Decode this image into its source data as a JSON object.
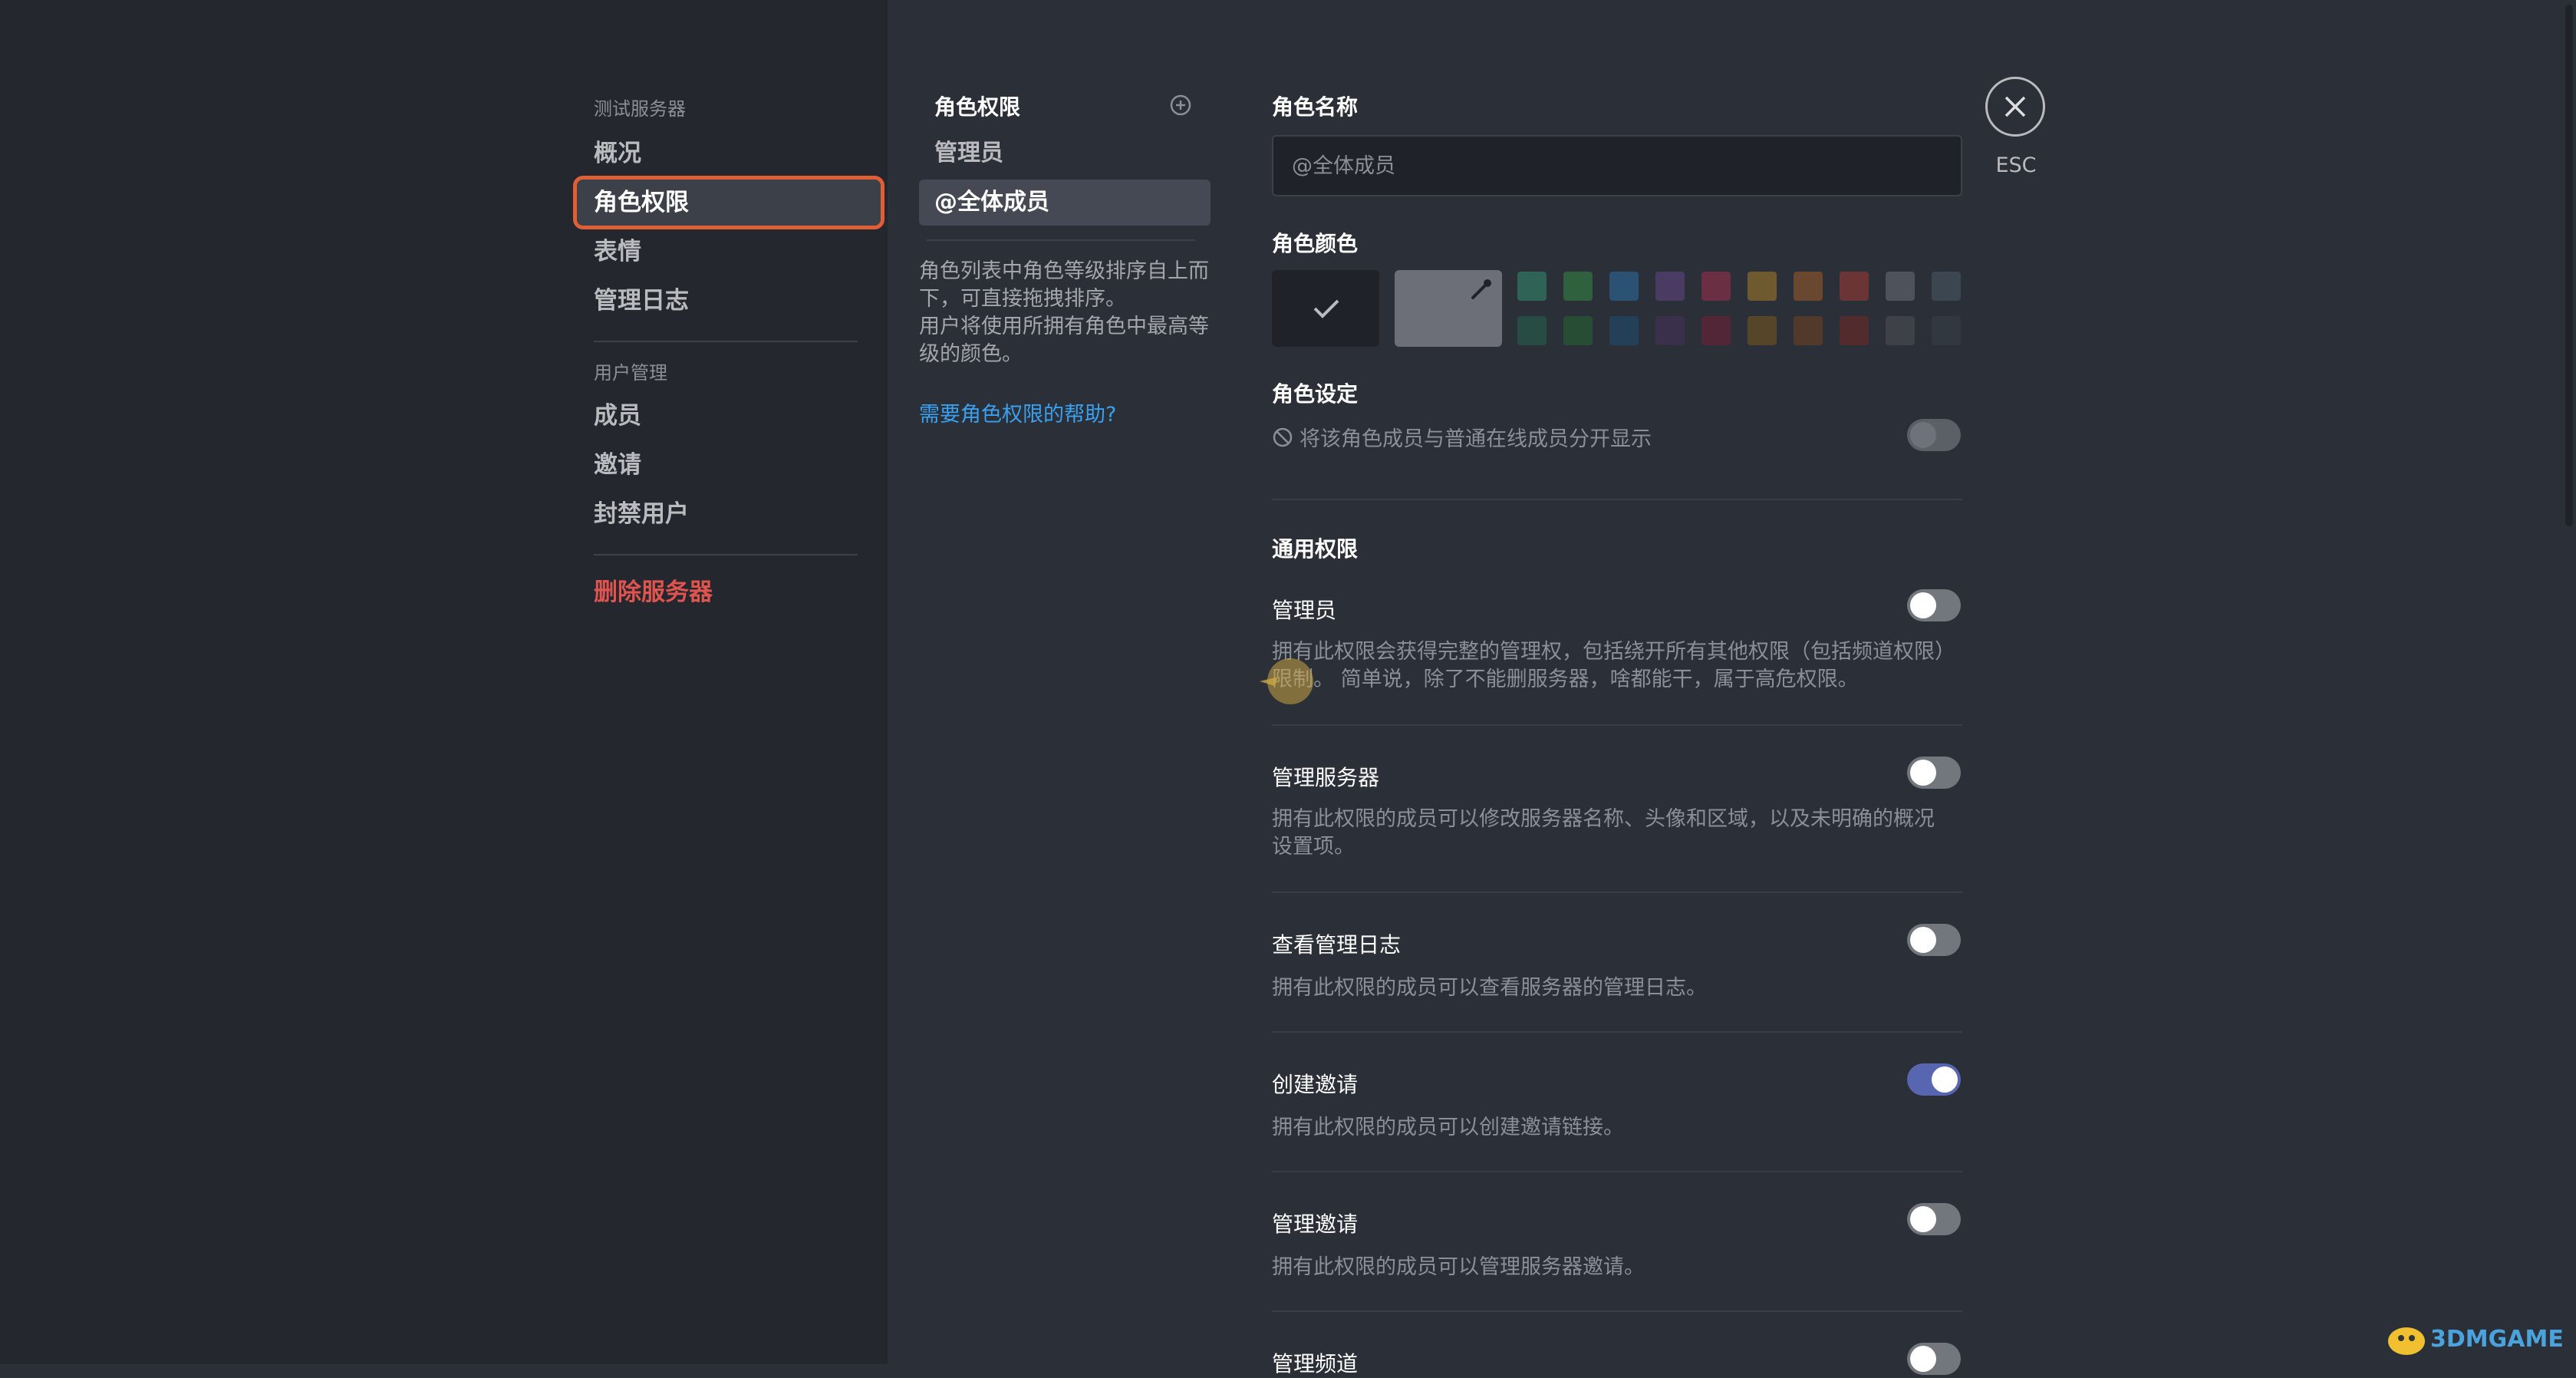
{
  "sidebar": {
    "server_header": "测试服务器",
    "server_items": [
      {
        "label": "概况"
      },
      {
        "label": "角色权限"
      },
      {
        "label": "表情"
      },
      {
        "label": "管理日志"
      }
    ],
    "user_header": "用户管理",
    "user_items": [
      {
        "label": "成员"
      },
      {
        "label": "邀请"
      },
      {
        "label": "封禁用户"
      }
    ],
    "delete_label": "删除服务器"
  },
  "roles": {
    "title": "角色权限",
    "items": [
      {
        "label": "管理员"
      },
      {
        "label": "@全体成员"
      }
    ],
    "desc1": "角色列表中角色等级排序自上而下，可直接拖拽排序。",
    "desc2": "用户将使用所拥有角色中最高等级的颜色。",
    "help": "需要角色权限的帮助?"
  },
  "form": {
    "name_label": "角色名称",
    "name_placeholder": "@全体成员",
    "color_label": "角色颜色",
    "colors_row1": [
      "#2f6355",
      "#30613f",
      "#2b5272",
      "#4a3b63",
      "#6b2f44",
      "#6e5a2e",
      "#6a4830",
      "#6b3535",
      "#4e535b",
      "#3c4650"
    ],
    "colors_row2": [
      "#264c44",
      "#274d34",
      "#243f58",
      "#3a304c",
      "#522636",
      "#55462a",
      "#523a2a",
      "#522c2c",
      "#3e4248",
      "#32383f"
    ],
    "settings_label": "角色设定",
    "hoist_text": "将该角色成员与普通在线成员分开显示",
    "general_label": "通用权限"
  },
  "permissions": [
    {
      "title": "管理员",
      "desc": "拥有此权限会获得完整的管理权，包括绕开所有其他权限（包括频道权限）限制。 简单说，除了不能删服务器，啥都能干，属于高危权限。",
      "enabled": false
    },
    {
      "title": "管理服务器",
      "desc": "拥有此权限的成员可以修改服务器名称、头像和区域，以及未明确的概况设置项。",
      "enabled": false
    },
    {
      "title": "查看管理日志",
      "desc": "拥有此权限的成员可以查看服务器的管理日志。",
      "enabled": false
    },
    {
      "title": "创建邀请",
      "desc": "拥有此权限的成员可以创建邀请链接。",
      "enabled": true
    },
    {
      "title": "管理邀请",
      "desc": "拥有此权限的成员可以管理服务器邀请。",
      "enabled": false
    },
    {
      "title": "管理频道",
      "desc": "",
      "enabled": false
    }
  ],
  "close": {
    "esc_label": "ESC"
  },
  "watermark": "3DMGAME"
}
